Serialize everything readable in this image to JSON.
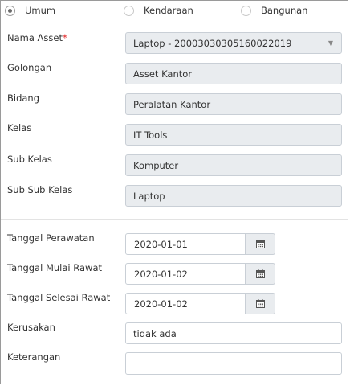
{
  "radio_options": [
    {
      "label": "Umum",
      "checked": true
    },
    {
      "label": "Kendaraan",
      "checked": false
    },
    {
      "label": "Bangunan",
      "checked": false
    }
  ],
  "asset": {
    "nama_asset_label": "Nama Asset",
    "required_mark": "*",
    "nama_asset_value": "Laptop - 20003030305160022019",
    "golongan_label": "Golongan",
    "golongan_value": "Asset Kantor",
    "bidang_label": "Bidang",
    "bidang_value": "Peralatan Kantor",
    "kelas_label": "Kelas",
    "kelas_value": "IT Tools",
    "sub_kelas_label": "Sub Kelas",
    "sub_kelas_value": "Komputer",
    "sub_sub_kelas_label": "Sub Sub Kelas",
    "sub_sub_kelas_value": "Laptop"
  },
  "maintenance": {
    "tanggal_perawatan_label": "Tanggal Perawatan",
    "tanggal_perawatan_value": "2020-01-01",
    "tanggal_mulai_label": "Tanggal Mulai Rawat",
    "tanggal_mulai_value": "2020-01-02",
    "tanggal_selesai_label": "Tanggal Selesai Rawat",
    "tanggal_selesai_value": "2020-01-02",
    "kerusakan_label": "Kerusakan",
    "kerusakan_value": "tidak ada",
    "keterangan_label": "Keterangan",
    "keterangan_value": ""
  },
  "icons": {
    "select_caret": "chevron-down-icon",
    "date_button": "calendar-icon"
  }
}
